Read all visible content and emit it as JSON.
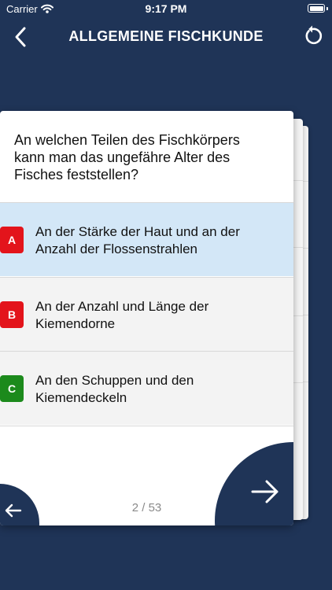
{
  "status_bar": {
    "carrier": "Carrier",
    "time": "9:17 PM"
  },
  "nav": {
    "title": "ALLGEMEINE FISCHKUNDE"
  },
  "question": {
    "text": "An welchen Teilen des Fischkörpers kann man das ungefähre Alter des Fisches feststellen?"
  },
  "answers": [
    {
      "letter": "A",
      "text": "An der Stärke der Haut und an der Anzahl der Flossenstrahlen",
      "badge_color": "#e3141b",
      "selected": true
    },
    {
      "letter": "B",
      "text": "An der Anzahl und Länge der Kiemendorne",
      "badge_color": "#e3141b",
      "selected": false
    },
    {
      "letter": "C",
      "text": "An den Schuppen und den Kiemendeckeln",
      "badge_color": "#1c8a1c",
      "selected": false
    }
  ],
  "pager": {
    "text": "2 / 53"
  },
  "colors": {
    "background": "#1f3457",
    "selected_answer": "#d3e7f7"
  },
  "icons": {
    "back": "chevron-left-icon",
    "reset": "reset-icon",
    "prev": "arrow-left-icon",
    "next": "arrow-right-icon",
    "wifi": "wifi-icon",
    "battery": "battery-icon"
  }
}
